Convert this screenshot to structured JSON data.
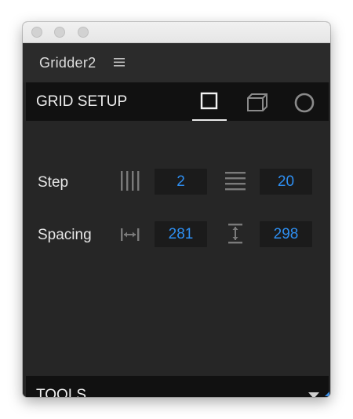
{
  "window": {
    "title_buttons": [
      "close",
      "minimize",
      "zoom"
    ]
  },
  "panel": {
    "title": "Gridder2",
    "menu_icon": "hamburger-menu-icon"
  },
  "grid_setup": {
    "title": "GRID SETUP",
    "tabs": [
      {
        "name": "rectangle-grid-tab",
        "icon": "square-icon",
        "active": true
      },
      {
        "name": "cube-grid-tab",
        "icon": "cube-icon",
        "active": false
      },
      {
        "name": "circle-grid-tab",
        "icon": "circle-icon",
        "active": false
      }
    ]
  },
  "step": {
    "label": "Step",
    "columns_icon": "vertical-lines-icon",
    "columns_value": "2",
    "rows_icon": "horizontal-lines-icon",
    "rows_value": "20"
  },
  "spacing": {
    "label": "Spacing",
    "horizontal_icon": "horizontal-spacing-icon",
    "horizontal_value": "281",
    "vertical_icon": "vertical-spacing-icon",
    "vertical_value": "298"
  },
  "tools": {
    "title": "TOOLS",
    "expand_icon": "triangle-down-icon"
  },
  "colors": {
    "panel_bg": "#262626",
    "bar_bg": "#111111",
    "field_bg": "#1b1b1b",
    "value_text": "#2e8ef0",
    "label_text": "#e6e6e6",
    "icon_gray": "#777777"
  }
}
